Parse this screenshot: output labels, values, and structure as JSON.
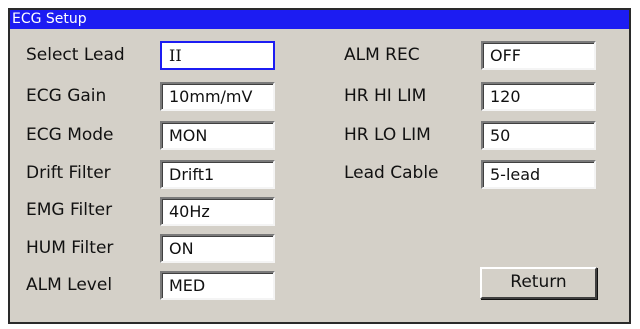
{
  "window": {
    "title": "ECG Setup"
  },
  "left": [
    {
      "label": "Select Lead",
      "value": "II"
    },
    {
      "label": "ECG Gain",
      "value": "10mm/mV"
    },
    {
      "label": "ECG Mode",
      "value": "MON"
    },
    {
      "label": "Drift Filter",
      "value": "Drift1"
    },
    {
      "label": "EMG Filter",
      "value": "40Hz"
    },
    {
      "label": "HUM Filter",
      "value": "ON"
    },
    {
      "label": "ALM Level",
      "value": "MED"
    }
  ],
  "right": [
    {
      "label": "ALM REC",
      "value": "OFF"
    },
    {
      "label": "HR HI LIM",
      "value": "120"
    },
    {
      "label": "HR LO LIM",
      "value": "50"
    },
    {
      "label": "Lead Cable",
      "value": "5-lead"
    }
  ],
  "buttons": {
    "return_label": "Return"
  },
  "colors": {
    "title_bar": "#1c1cf2",
    "panel": "#d4d0c8",
    "field": "#ffffff",
    "focus": "#1c1cf2"
  }
}
